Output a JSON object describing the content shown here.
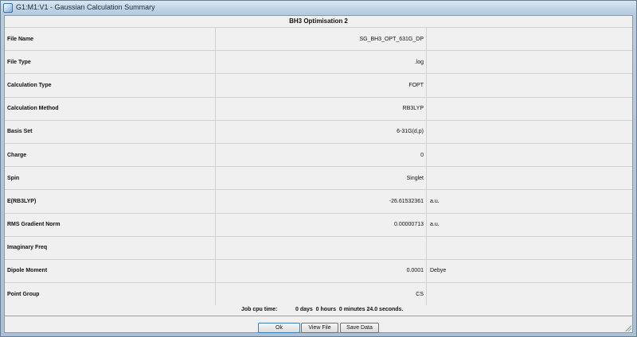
{
  "window": {
    "title": "G1:M1:V1 - Gaussian Calculation Summary"
  },
  "table": {
    "title": "BH3 Optimisation 2",
    "rows": [
      {
        "label": "File Name",
        "value": "SG_BH3_OPT_631G_DP",
        "unit": ""
      },
      {
        "label": "File Type",
        "value": ".log",
        "unit": ""
      },
      {
        "label": "Calculation Type",
        "value": "FOPT",
        "unit": ""
      },
      {
        "label": "Calculation Method",
        "value": "RB3LYP",
        "unit": ""
      },
      {
        "label": "Basis Set",
        "value": "6-31G(d,p)",
        "unit": ""
      },
      {
        "label": "Charge",
        "value": "0",
        "unit": ""
      },
      {
        "label": "Spin",
        "value": "Singlet",
        "unit": ""
      },
      {
        "label": "E(RB3LYP)",
        "value": "-26.61532361",
        "unit": "a.u."
      },
      {
        "label": "RMS Gradient Norm",
        "value": "0.00000713",
        "unit": "a.u."
      },
      {
        "label": "Imaginary Freq",
        "value": "",
        "unit": ""
      },
      {
        "label": "Dipole Moment",
        "value": "0.0001",
        "unit": "Debye"
      },
      {
        "label": "Point Group",
        "value": "CS",
        "unit": ""
      }
    ],
    "cpu_label": "Job cpu time:",
    "cpu_value": "0 days  0 hours  0 minutes 24.0 seconds."
  },
  "buttons": {
    "ok": "Ok",
    "view_file": "View File",
    "save_data": "Save Data"
  }
}
